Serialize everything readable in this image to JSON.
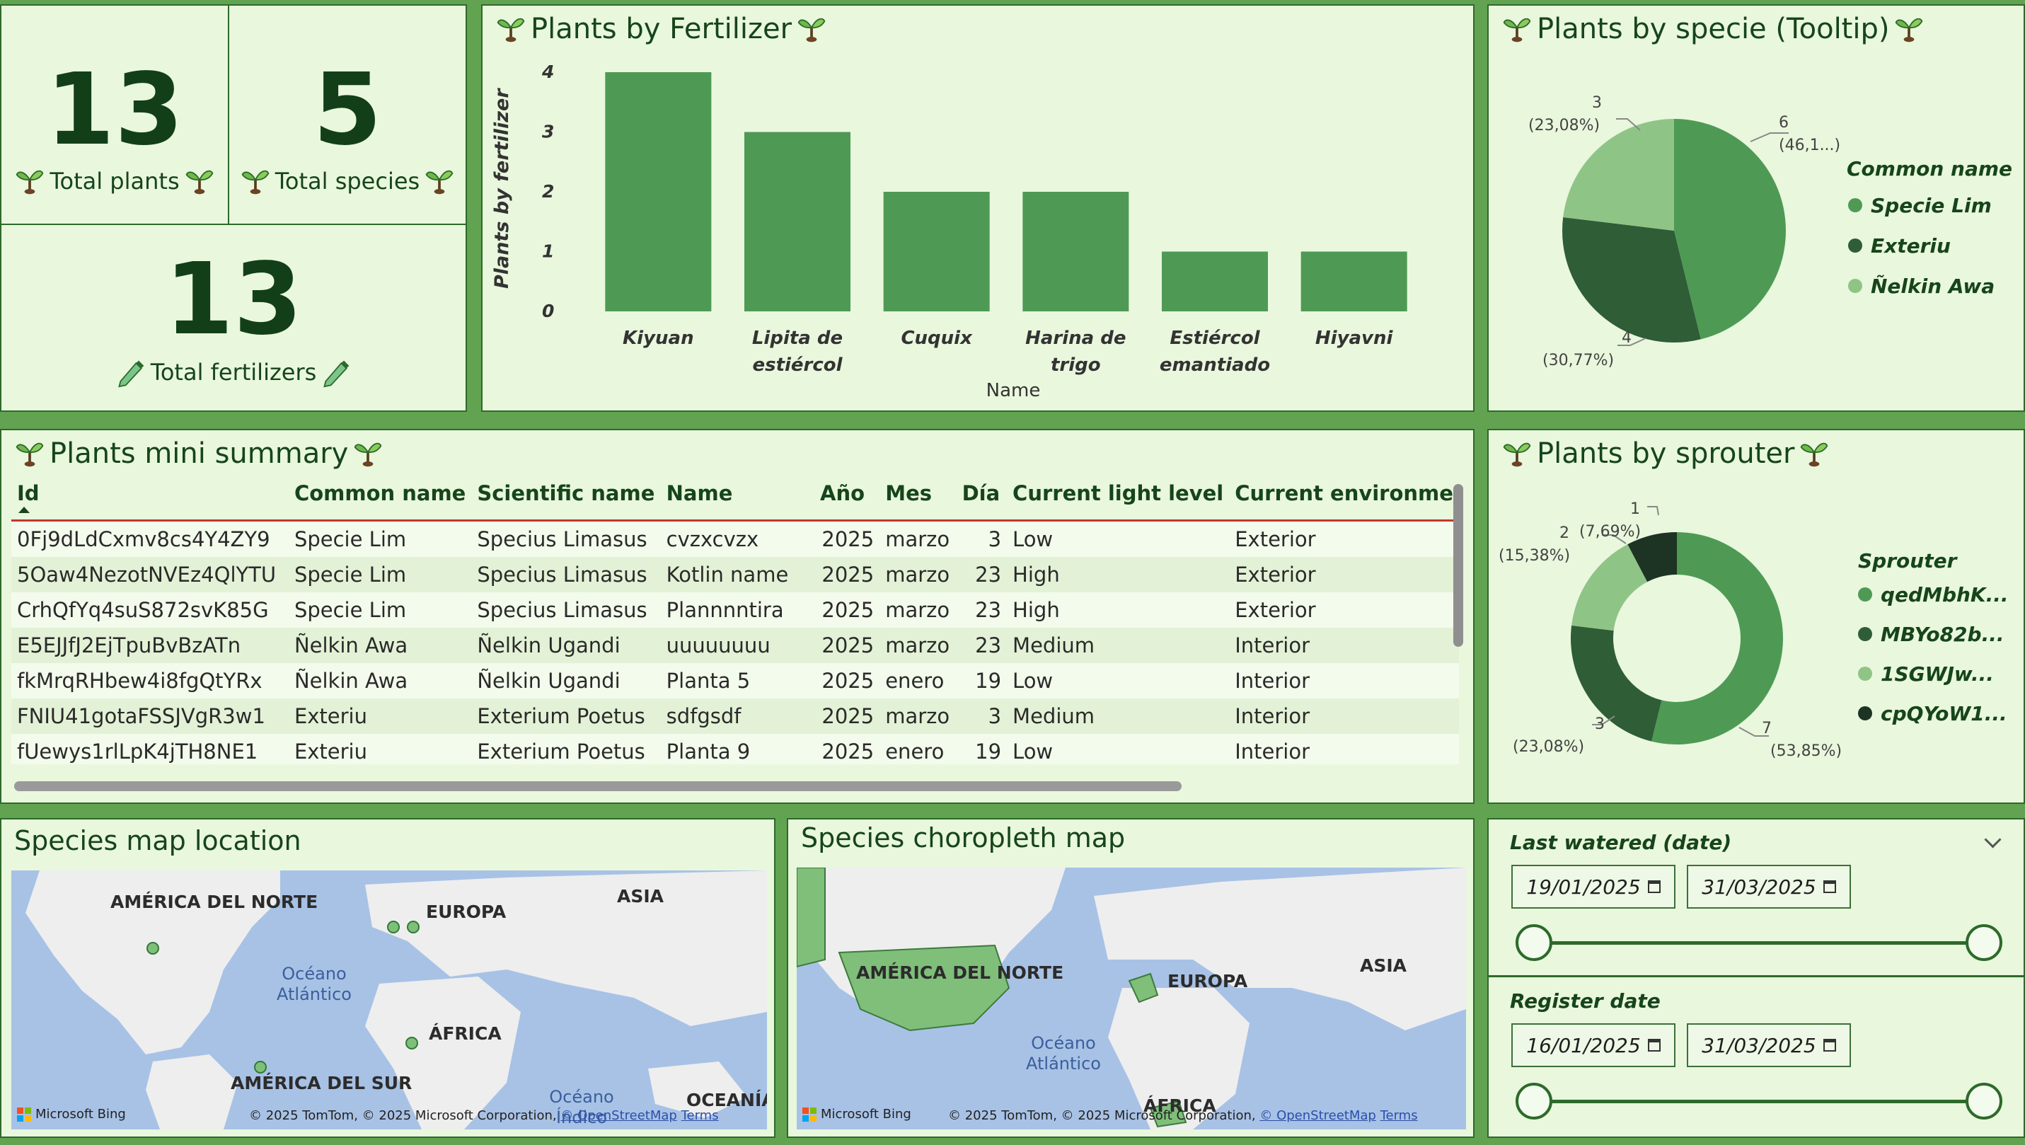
{
  "colors": {
    "background": "#62a351",
    "panel": "#e9f7dd",
    "bar": "#4e9a55",
    "dark": "#2e5d36",
    "light": "#8fc487",
    "title": "#16451a"
  },
  "kpis": {
    "total_plants": {
      "value": "13",
      "label": "Total plants"
    },
    "total_species": {
      "value": "5",
      "label": "Total species"
    },
    "total_fertilizers": {
      "value": "13",
      "label": "Total fertilizers"
    }
  },
  "fertilizer_panel": {
    "title": "Plants by Fertilizer"
  },
  "species_panel": {
    "title": "Plants by specie (Tooltip)",
    "legend_title": "Common name",
    "slice_labels": [
      {
        "value": "6",
        "pct": "(46,1...)"
      },
      {
        "value": "4",
        "pct": "(30,77%)"
      },
      {
        "value": "3",
        "pct": "(23,08%)"
      }
    ]
  },
  "sprouter_panel": {
    "title": "Plants by sprouter",
    "legend_title": "Sprouter",
    "slice_labels": [
      {
        "value": "7",
        "pct": "(53,85%)"
      },
      {
        "value": "3",
        "pct": "(23,08%)"
      },
      {
        "value": "2",
        "pct": "(15,38%)"
      },
      {
        "value": "1",
        "pct": "(7,69%)"
      }
    ]
  },
  "chart_data": [
    {
      "type": "bar",
      "title": "Plants by Fertilizer",
      "xlabel": "Name",
      "ylabel": "Plants by fertilizer",
      "categories": [
        "Kiyuan",
        "Lipita de estiércol",
        "Cuquix",
        "Harina de trigo",
        "Estiércol emantiado",
        "Hiyavni"
      ],
      "values": [
        4,
        3,
        2,
        2,
        1,
        1
      ],
      "ylim": [
        0,
        4
      ],
      "yticks": [
        "0",
        "1",
        "2",
        "3",
        "4"
      ],
      "grid": false
    },
    {
      "type": "pie",
      "title": "Plants by specie (Tooltip)",
      "legend_title": "Common name",
      "legend_position": "right",
      "series": [
        {
          "name": "Specie Lim",
          "value": 6,
          "percent": 46.15,
          "color": "#4e9a55"
        },
        {
          "name": "Exteriu",
          "value": 4,
          "percent": 30.77,
          "color": "#2e5d36"
        },
        {
          "name": "Ñelkin Awa",
          "value": 3,
          "percent": 23.08,
          "color": "#8fc487"
        }
      ]
    },
    {
      "type": "pie",
      "title": "Plants by sprouter",
      "legend_title": "Sprouter",
      "legend_position": "right",
      "donut": true,
      "series": [
        {
          "name": "qedMbhK...",
          "value": 7,
          "percent": 53.85,
          "color": "#4e9a55"
        },
        {
          "name": "MBYo82b...",
          "value": 3,
          "percent": 23.08,
          "color": "#2e5d36"
        },
        {
          "name": "1SGWJw...",
          "value": 2,
          "percent": 15.38,
          "color": "#8fc487"
        },
        {
          "name": "cpQYoW1...",
          "value": 1,
          "percent": 7.69,
          "color": "#1d3324"
        }
      ]
    }
  ],
  "summary": {
    "title": "Plants mini summary",
    "columns": [
      "Id",
      "Common name",
      "Scientific name",
      "Name",
      "Año",
      "Mes",
      "Día",
      "Current light level",
      "Current environme"
    ],
    "rows": [
      [
        "0Fj9dLdCxmv8cs4Y4ZY9",
        "Specie Lim",
        "Specius Limasus",
        "cvzxcvzx",
        "2025",
        "marzo",
        "3",
        "Low",
        "Exterior"
      ],
      [
        "5Oaw4NezotNVEz4QlYTU",
        "Specie Lim",
        "Specius Limasus",
        "Kotlin name",
        "2025",
        "marzo",
        "23",
        "High",
        "Exterior"
      ],
      [
        "CrhQfYq4suS872svK85G",
        "Specie Lim",
        "Specius Limasus",
        "Plannnntira",
        "2025",
        "marzo",
        "23",
        "High",
        "Exterior"
      ],
      [
        "E5EJJfJ2EjTpuBvBzATn",
        "Ñelkin Awa",
        "Ñelkin Ugandi",
        "uuuuuuuu",
        "2025",
        "marzo",
        "23",
        "Medium",
        "Interior"
      ],
      [
        "fkMrqRHbew4i8fgQtYRx",
        "Ñelkin Awa",
        "Ñelkin Ugandi",
        "Planta 5",
        "2025",
        "enero",
        "19",
        "Low",
        "Interior"
      ],
      [
        "FNIU41gotaFSSJVgR3w1",
        "Exteriu",
        "Exterium Poetus",
        "sdfgsdf",
        "2025",
        "marzo",
        "3",
        "Medium",
        "Interior"
      ],
      [
        "fUewys1rlLpK4jTH8NE1",
        "Exteriu",
        "Exterium Poetus",
        "Planta 9",
        "2025",
        "enero",
        "19",
        "Low",
        "Interior"
      ]
    ]
  },
  "map_location": {
    "title": "Species map location",
    "labels": {
      "na": "AMÉRICA DEL NORTE",
      "eu": "EUROPA",
      "asia": "ASIA",
      "africa": "ÁFRICA",
      "sa": "AMÉRICA DEL SUR",
      "oceania": "OCEANÍA",
      "atl": "Océano Atlántico",
      "ind": "Océano Índico"
    },
    "bing": "Microsoft Bing",
    "credit": "© 2025 TomTom, © 2025 Microsoft Corporation,",
    "osm": "© OpenStreetMap",
    "terms": "Terms"
  },
  "map_choropleth": {
    "title": "Species choropleth map",
    "labels": {
      "na": "AMÉRICA DEL NORTE",
      "eu": "EUROPA",
      "asia": "ASIA",
      "africa": "ÁFRICA",
      "atl": "Océano Atlántico"
    },
    "bing": "Microsoft Bing",
    "credit": "© 2025 TomTom, © 2025 Microsoft Corporation,",
    "osm": "© OpenStreetMap",
    "terms": "Terms"
  },
  "slicers": {
    "last_watered": {
      "title": "Last watered (date)",
      "start": "19/01/2025",
      "end": "31/03/2025"
    },
    "register": {
      "title": "Register date",
      "start": "16/01/2025",
      "end": "31/03/2025"
    }
  }
}
